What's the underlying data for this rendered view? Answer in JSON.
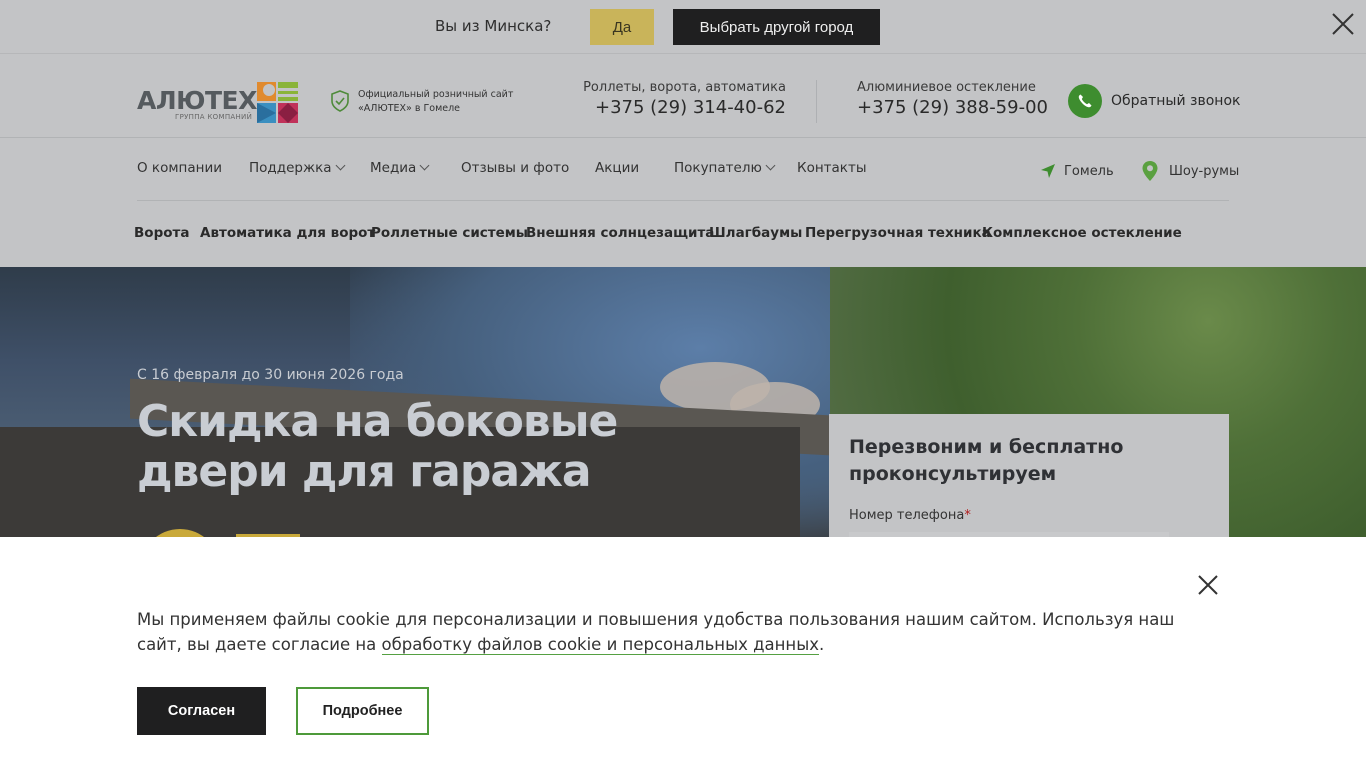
{
  "city_bar": {
    "question": "Вы из Минска?",
    "yes_label": "Да",
    "other_city_label": "Выбрать другой город"
  },
  "header": {
    "logo_text": "АЛЮТЕХ",
    "logo_sub": "ГРУППА КОМПАНИЙ",
    "official_line1": "Официальный розничный сайт",
    "official_line2": "«АЛЮТЕХ» в Гомеле",
    "phone1_label": "Роллеты, ворота, автоматика",
    "phone1_number": "+375 (29) 314-40-62",
    "phone2_label": "Алюминиевое остекление",
    "phone2_number": "+375 (29) 388-59-00",
    "callback_label": "Обратный звонок",
    "colors": {
      "accent_green": "#3e8d2f",
      "accent_yellow": "#c9b45a"
    }
  },
  "nav_main": [
    {
      "label": "О компании",
      "dropdown": false
    },
    {
      "label": "Поддержка",
      "dropdown": true
    },
    {
      "label": "Медиа",
      "dropdown": true
    },
    {
      "label": "Отзывы и фото",
      "dropdown": false
    },
    {
      "label": "Акции",
      "dropdown": false
    },
    {
      "label": "Покупателю",
      "dropdown": true
    },
    {
      "label": "Контакты",
      "dropdown": false
    }
  ],
  "nav_right": {
    "city": "Гомель",
    "showrooms": "Шоу-румы"
  },
  "nav_categories": [
    "Ворота",
    "Автоматика для ворот",
    "Роллетные системы",
    "Внешняя солнцезащита",
    "Шлагбаумы",
    "Перегрузочная техника",
    "Комплексное остекление"
  ],
  "hero": {
    "date": "С 16 февраля до 30 июня 2026 года",
    "title_line1": "Скидка на боковые",
    "title_line2": "двери для гаража"
  },
  "callback_form": {
    "title": "Перезвоним и бесплатно проконсультируем",
    "phone_label": "Номер телефона",
    "required_mark": "*"
  },
  "cookie": {
    "message_pre": "Мы применяем файлы cookie для персонализации и повышения удобства пользования нашим сайтом. Используя наш сайт, вы даете согласие на ",
    "message_link": "обработку файлов cookie и персональных данных",
    "message_post": ".",
    "agree_label": "Согласен",
    "more_label": "Подробнее"
  }
}
